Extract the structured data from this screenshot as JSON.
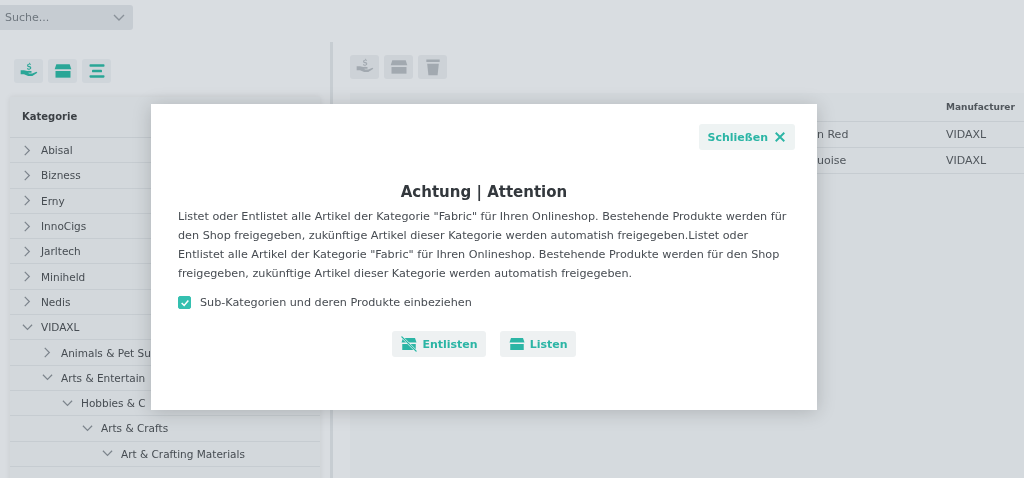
{
  "search": {
    "placeholder": "Suche..."
  },
  "left_toolbar": [
    {
      "kind": "price",
      "disabled": false
    },
    {
      "kind": "store",
      "disabled": false
    },
    {
      "kind": "menu",
      "disabled": false
    }
  ],
  "tree": {
    "header": "Kategorie",
    "items": [
      {
        "label": "Abisal",
        "expanded": false
      },
      {
        "label": "Bizness",
        "expanded": false
      },
      {
        "label": "Erny",
        "expanded": false
      },
      {
        "label": "InnoCigs",
        "expanded": false
      },
      {
        "label": "Jarltech",
        "expanded": false
      },
      {
        "label": "Miniheld",
        "expanded": false
      },
      {
        "label": "Nedis",
        "expanded": false
      },
      {
        "label": "VIDAXL",
        "expanded": true,
        "children": [
          {
            "label": "Animals & Pet Su",
            "expanded": false
          },
          {
            "label": "Arts & Entertain",
            "expanded": true,
            "children": [
              {
                "label": "Hobbies & C",
                "expanded": true,
                "children": [
                  {
                    "label": "Arts & Crafts",
                    "expanded": true,
                    "children": [
                      {
                        "label": "Art & Crafting Materials",
                        "expanded": true
                      }
                    ]
                  }
                ]
              }
            ]
          }
        ]
      }
    ]
  },
  "right_toolbar": [
    {
      "kind": "price",
      "disabled": true
    },
    {
      "kind": "store",
      "disabled": true
    },
    {
      "kind": "trash",
      "disabled": true
    }
  ],
  "table": {
    "columns": [
      "Manufacturer"
    ],
    "rows": [
      {
        "column_1": "n Red",
        "manufacturer": "VIDAXL"
      },
      {
        "column_1": "uoise",
        "manufacturer": "VIDAXL"
      }
    ]
  },
  "dialog": {
    "close_label": "Schließen",
    "title": "Achtung | Attention",
    "text": "Listet oder Entlistet alle Artikel der Kategorie \"Fabric\" für Ihren Onlineshop. Bestehende Produkte werden für den Shop freigegeben, zukünftige Artikel dieser Kategorie werden automatish freigegeben.Listet oder Entlistet alle Artikel der Kategorie \"Fabric\" für Ihren Onlineshop. Bestehende Produkte werden für den Shop freigegeben, zukünftige Artikel dieser Kategorie werden automatish freigegeben.",
    "checkbox": {
      "label": "Sub-Kategorien und deren Produkte einbeziehen",
      "checked": true
    },
    "buttons": [
      {
        "kind": "unlist",
        "label": "Entlisten"
      },
      {
        "kind": "list",
        "label": "Listen"
      }
    ]
  }
}
